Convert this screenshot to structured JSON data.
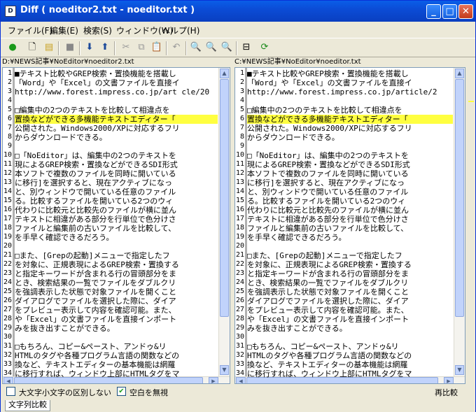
{
  "window": {
    "title": "Diff ( noeditor2.txt - noeditor.txt )",
    "app_icon": "diff-app-icon",
    "controls": {
      "minimize": "_",
      "maximize": "□",
      "close": "✕"
    }
  },
  "menu": [
    "ファイル(F)",
    "編集(E)",
    "検索(S)",
    "ウィンドウ(W)",
    "ヘルプ(H)"
  ],
  "toolbar": {
    "icons": [
      "go-icon",
      "new-file-icon",
      "open-folder-icon",
      "stop-icon",
      "down-arrow-icon",
      "up-arrow-icon",
      "cut-icon",
      "copy-icon",
      "paste-icon",
      "undo-icon",
      "zoom-icon",
      "zoom-in-icon",
      "zoom-out-icon",
      "split-icon",
      "refresh-icon"
    ]
  },
  "left_pane": {
    "path": "D:¥NEWS記事¥NoEditor¥noeditor2.txt",
    "lines": [
      {
        "n": "1",
        "t": "■テキスト比較やGREP検索・置換機能を搭載し"
      },
      {
        "n": "2",
        "t": "「Word」や「Excel」の文書ファイルを直接イ"
      },
      {
        "n": "3",
        "t": "http://www.forest.impress.co.jp/art cle/20"
      },
      {
        "n": "4",
        "t": ""
      },
      {
        "n": "5",
        "t": "□編集中の2つのテキストを比較して相違点を"
      },
      {
        "n": "6",
        "t": "置換などができる多機能テキストエディター「",
        "hl": true
      },
      {
        "n": "7",
        "t": "公開された。Windows2000/XPに対応するフリ"
      },
      {
        "n": "8",
        "t": "からダウンロードできる。"
      },
      {
        "n": "9",
        "t": ""
      },
      {
        "n": "10",
        "t": "□「NoEditor」は、編集中の2つのテキストを"
      },
      {
        "n": "11",
        "t": "現によるGREP検索・置換などができるSDI形式"
      },
      {
        "n": "12",
        "t": "本ソフトで複数のファイルを同時に開いている"
      },
      {
        "n": "13",
        "t": "に移行]を選択すると、現在アクティブになっ"
      },
      {
        "n": "14",
        "t": "と、別ウィンドウで開いている任意のファイル"
      },
      {
        "n": "15",
        "t": "る。比較するファイルを開いている2つのウィ"
      },
      {
        "n": "16",
        "t": "代わりに比較元と比較先のファイルが横に並ん"
      },
      {
        "n": "17",
        "t": "テキストに相違がある部分を行単位で色分けさ"
      },
      {
        "n": "18",
        "t": "ファイルと編集前の古いファイルを比較して、"
      },
      {
        "n": "19",
        "t": "を手早く確認できるだろう。"
      },
      {
        "n": "20",
        "t": ""
      },
      {
        "n": "21",
        "t": "□また、[Grepの起動]メニューで指定したフ"
      },
      {
        "n": "22",
        "t": "を対象に、正規表現によるGREP検索・置換する"
      },
      {
        "n": "23",
        "t": "と指定キーワードが含まれる行の冒頭部分をま"
      },
      {
        "n": "24",
        "t": "とき、検索結果の一覧でファイルをダブルクリ"
      },
      {
        "n": "25",
        "t": "を強調表示した状態で対象ファイルを開くこと"
      },
      {
        "n": "26",
        "t": "ダイアログでファイルを選択した際に、ダイア"
      },
      {
        "n": "27",
        "t": "をプレビュー表示して内容を確認可能。また、"
      },
      {
        "n": "28",
        "t": "や「Excel」の文書ファイルを直接インポート"
      },
      {
        "n": "29",
        "t": "みを抜き出すことができる。"
      },
      {
        "n": "30",
        "t": ""
      },
      {
        "n": "31",
        "t": "□もちろん、コピー&ペースト、アンドゥ&リ"
      },
      {
        "n": "32",
        "t": "HTMLのタグや各種プログラム言語の関数などの"
      },
      {
        "n": "33",
        "t": "換など、テキストエディターの基本機能は網羅"
      },
      {
        "n": "34",
        "t": "に移行すれば、ウィンドウ上部にHTMLタグをマ"
      }
    ]
  },
  "right_pane": {
    "path": "C:¥NEWS記事¥NoEditor¥noeditor.txt",
    "lines": [
      {
        "n": "1",
        "t": "■テキスト比較やGREP検索・置換機能を搭載し"
      },
      {
        "n": "2",
        "t": "「Word」や「Excel」の文書ファイルを直接イ"
      },
      {
        "n": "3",
        "t": "http://www.forest.impress.co.jp/article/2"
      },
      {
        "n": "4",
        "t": ""
      },
      {
        "n": "5",
        "t": "□編集中の2つのテキストを比較して相違点を"
      },
      {
        "n": "6",
        "t": "置換などができる多機能テキストエディター「",
        "hl": true
      },
      {
        "n": "7",
        "t": "公開された。Windows2000/XPに対応するフリ"
      },
      {
        "n": "8",
        "t": "からダウンロードできる。"
      },
      {
        "n": "9",
        "t": ""
      },
      {
        "n": "10",
        "t": "□「NoEditor」は、編集中の2つのテキストを"
      },
      {
        "n": "11",
        "t": "現によるGREP検索・置換などができるSDI形式"
      },
      {
        "n": "12",
        "t": "本ソフトで複数のファイルを同時に開いている"
      },
      {
        "n": "13",
        "t": "に移行]を選択すると、現在アクティブになっ"
      },
      {
        "n": "14",
        "t": "と、別ウィンドウで開いている任意のファイル"
      },
      {
        "n": "15",
        "t": "る。比較するファイルを開いている2つのウィ"
      },
      {
        "n": "16",
        "t": "代わりに比較元と比較先のファイルが横に並ん"
      },
      {
        "n": "17",
        "t": "テキストに相違がある部分を行単位で色分けさ"
      },
      {
        "n": "18",
        "t": "ファイルと編集前の古いファイルを比較して、"
      },
      {
        "n": "19",
        "t": "を手早く確認できるだろう。"
      },
      {
        "n": "20",
        "t": ""
      },
      {
        "n": "21",
        "t": "□また、[Grepの起動]メニューで指定したフ"
      },
      {
        "n": "22",
        "t": "を対象に、正規表現によるGREP検索・置換する"
      },
      {
        "n": "23",
        "t": "と指定キーワードが含まれる行の冒頭部分をま"
      },
      {
        "n": "24",
        "t": "とき、検索結果の一覧でファイルをダブルクリ"
      },
      {
        "n": "25",
        "t": "を強調表示した状態で対象ファイルを開くこと"
      },
      {
        "n": "26",
        "t": "ダイアログでファイルを選択した際に、ダイア"
      },
      {
        "n": "27",
        "t": "をプレビュー表示して内容を確認可能。また、"
      },
      {
        "n": "28",
        "t": "や「Excel」の文書ファイルを直接インポート"
      },
      {
        "n": "29",
        "t": "みを抜き出すことができる。"
      },
      {
        "n": "30",
        "t": ""
      },
      {
        "n": "31",
        "t": "□もちろん、コピー&ペースト、アンドゥ&リ"
      },
      {
        "n": "32",
        "t": "HTMLのタグや各種プログラム言語の関数などの"
      },
      {
        "n": "33",
        "t": "換など、テキストエディターの基本機能は網羅"
      },
      {
        "n": "34",
        "t": "に移行すれば、ウィンドウ上部にHTMLタグをマ"
      }
    ]
  },
  "options": {
    "ignore_case_label": "大文字小文字の区別しない",
    "ignore_case_checked": false,
    "ignore_space_label": "空白を無視",
    "ignore_space_checked": true,
    "recompare_label": "再比較"
  },
  "tab": {
    "label": "文字列比較"
  },
  "colors": {
    "highlight": "#ffff40",
    "titlebar": "#0a5ee8",
    "diff_marker": "#cc0000"
  }
}
